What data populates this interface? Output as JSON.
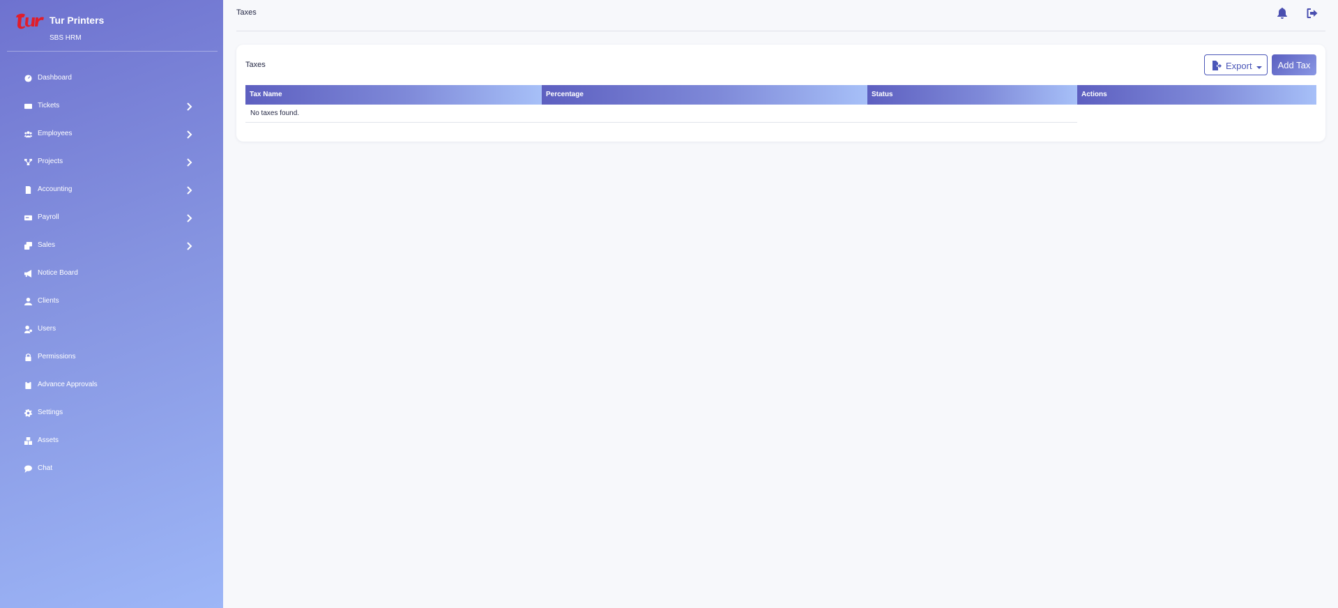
{
  "brand": {
    "name": "Tur Printers",
    "subtitle": "SBS HRM",
    "logo_color": "#e11d2a"
  },
  "sidebar": {
    "items": [
      {
        "label": "Dashboard",
        "icon": "dashboard-icon",
        "has_children": false
      },
      {
        "label": "Tickets",
        "icon": "ticket-icon",
        "has_children": true
      },
      {
        "label": "Employees",
        "icon": "users-icon",
        "has_children": true
      },
      {
        "label": "Projects",
        "icon": "project-diagram-icon",
        "has_children": true
      },
      {
        "label": "Accounting",
        "icon": "file-invoice-icon",
        "has_children": true
      },
      {
        "label": "Payroll",
        "icon": "money-check-icon",
        "has_children": true
      },
      {
        "label": "Sales",
        "icon": "layers-icon",
        "has_children": true
      },
      {
        "label": "Notice Board",
        "icon": "bullhorn-icon",
        "has_children": false
      },
      {
        "label": "Clients",
        "icon": "user-icon",
        "has_children": false
      },
      {
        "label": "Users",
        "icon": "user-gear-icon",
        "has_children": false
      },
      {
        "label": "Permissions",
        "icon": "lock-icon",
        "has_children": false
      },
      {
        "label": "Advance Approvals",
        "icon": "clipboard-check-icon",
        "has_children": false
      },
      {
        "label": "Settings",
        "icon": "gear-icon",
        "has_children": false
      },
      {
        "label": "Assets",
        "icon": "boxes-icon",
        "has_children": false
      },
      {
        "label": "Chat",
        "icon": "chat-bubble-icon",
        "has_children": false
      }
    ]
  },
  "header": {
    "title": "Taxes"
  },
  "card": {
    "title": "Taxes",
    "export_label": "Export",
    "add_label": "Add Tax"
  },
  "table": {
    "columns": [
      "Tax Name",
      "Percentage",
      "Status",
      "Actions"
    ],
    "empty_text": "No taxes found."
  },
  "colors": {
    "accent": "#4a56b8",
    "sidebar_start": "#6e72cf",
    "sidebar_end": "#9db6f7"
  }
}
